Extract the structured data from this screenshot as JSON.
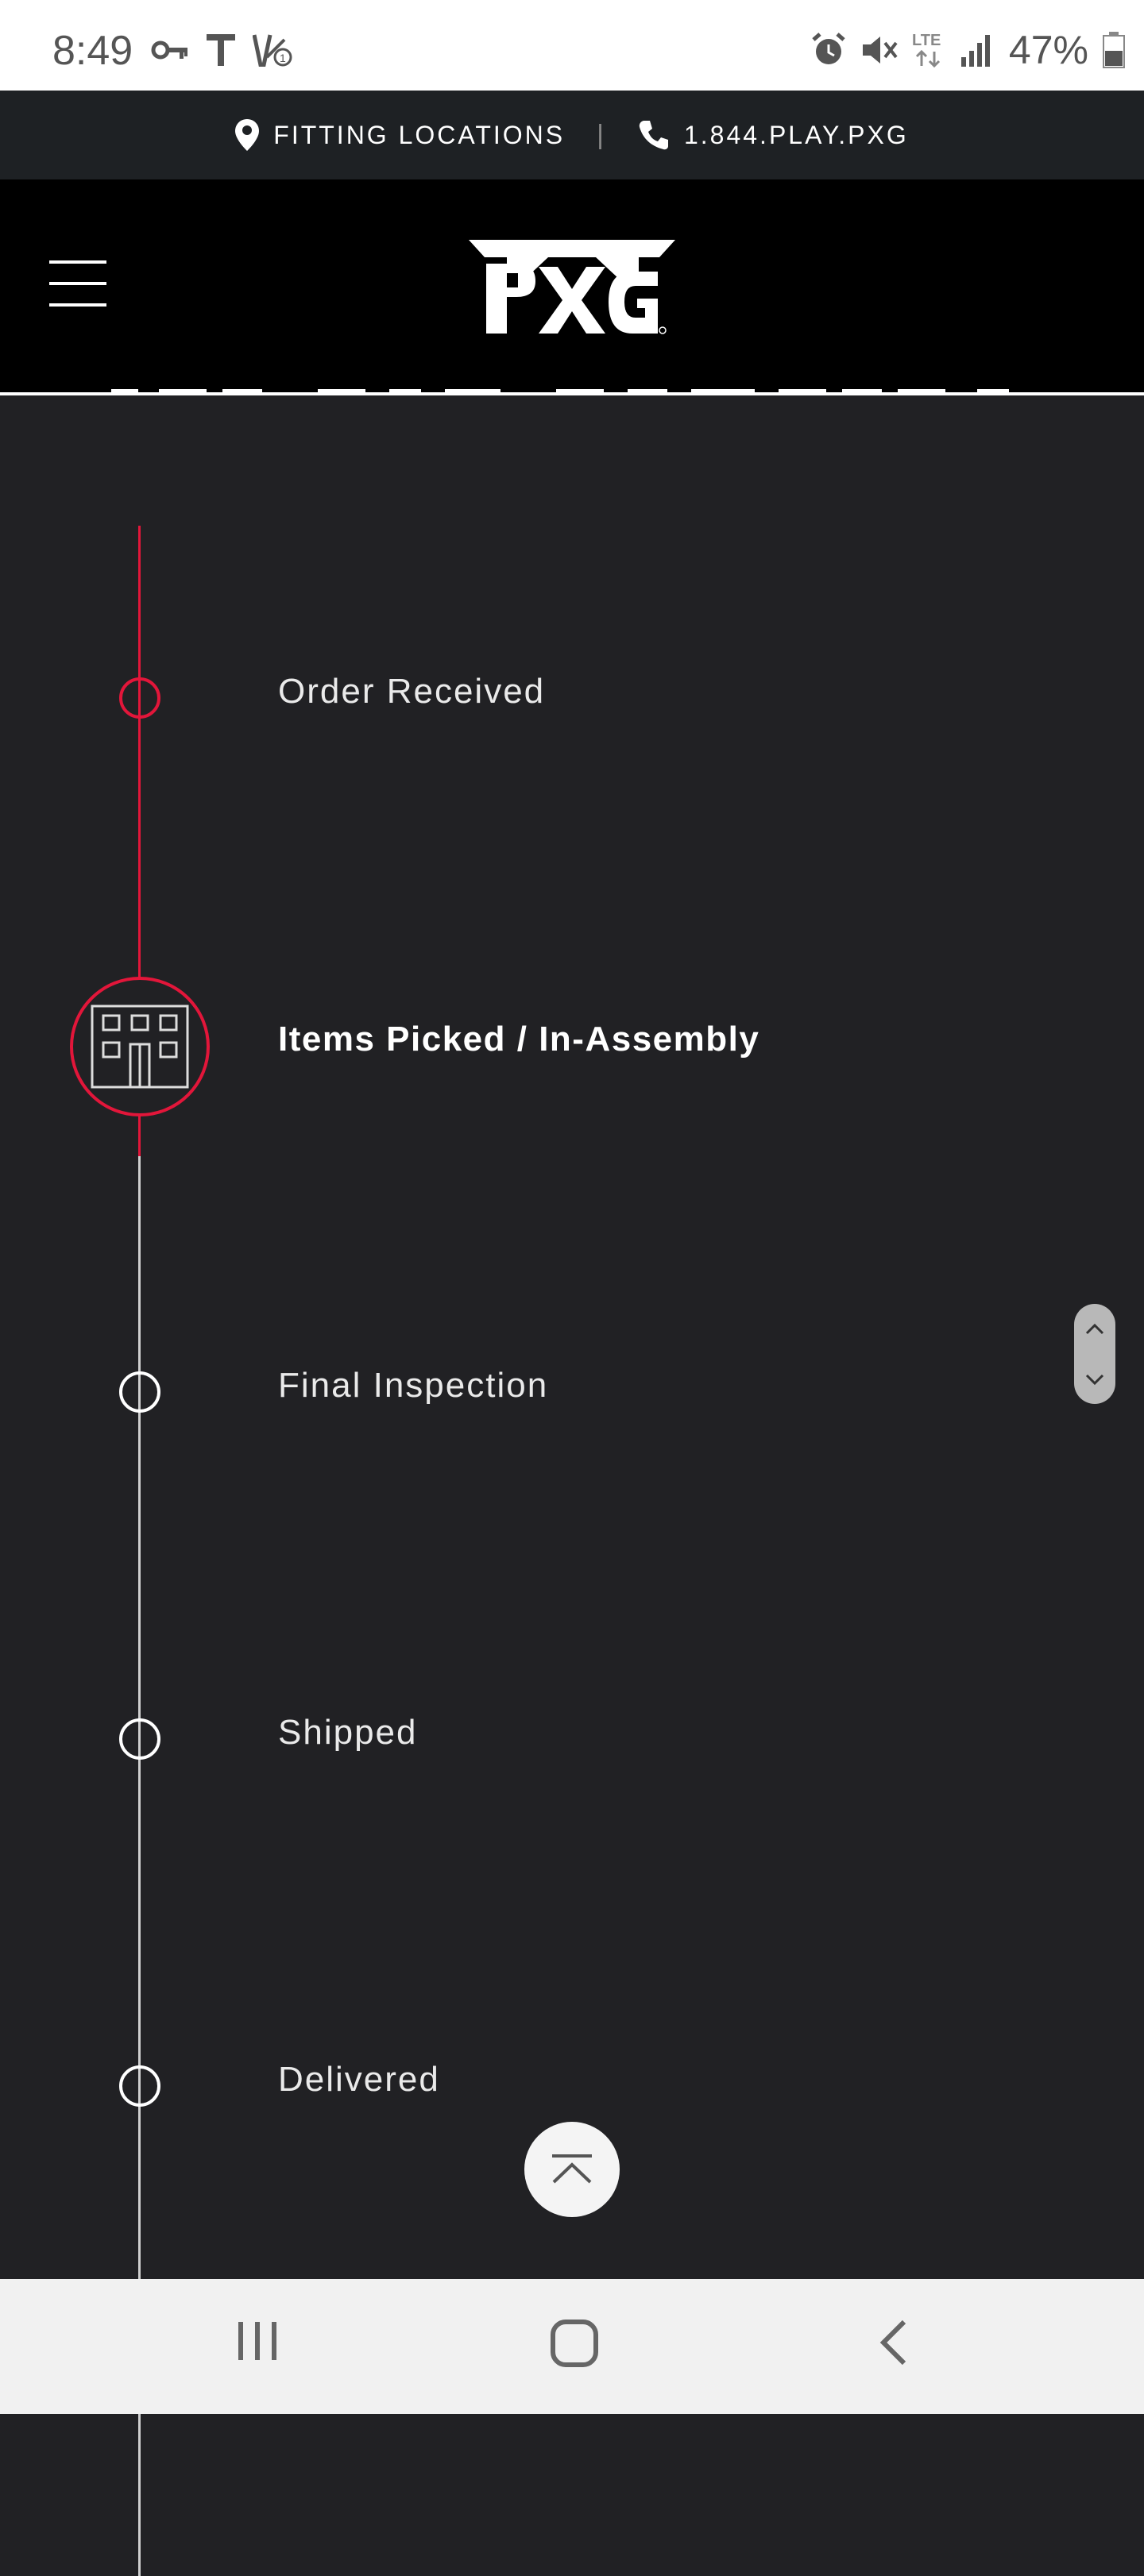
{
  "status_bar": {
    "time": "8:49",
    "battery": "47%",
    "left_icons": [
      "key-icon",
      "t-icon",
      "notification-icon"
    ],
    "right_icons": [
      "alarm-icon",
      "mute-icon",
      "lte-icon",
      "signal-icon",
      "battery-icon"
    ]
  },
  "utility_bar": {
    "locations_label": "FITTING LOCATIONS",
    "separator": "|",
    "phone_label": "1.844.PLAY.PXG"
  },
  "header": {
    "logo_text": "PXG"
  },
  "timeline": {
    "steps": [
      {
        "label": "Order Received",
        "state": "complete"
      },
      {
        "label": "Items Picked / In-Assembly",
        "state": "current"
      },
      {
        "label": "Final Inspection",
        "state": "pending"
      },
      {
        "label": "Shipped",
        "state": "pending"
      },
      {
        "label": "Delivered",
        "state": "pending"
      }
    ]
  },
  "colors": {
    "accent": "#e2163a",
    "background": "#212124",
    "header": "#000000",
    "utility_bar": "#1e2124"
  }
}
